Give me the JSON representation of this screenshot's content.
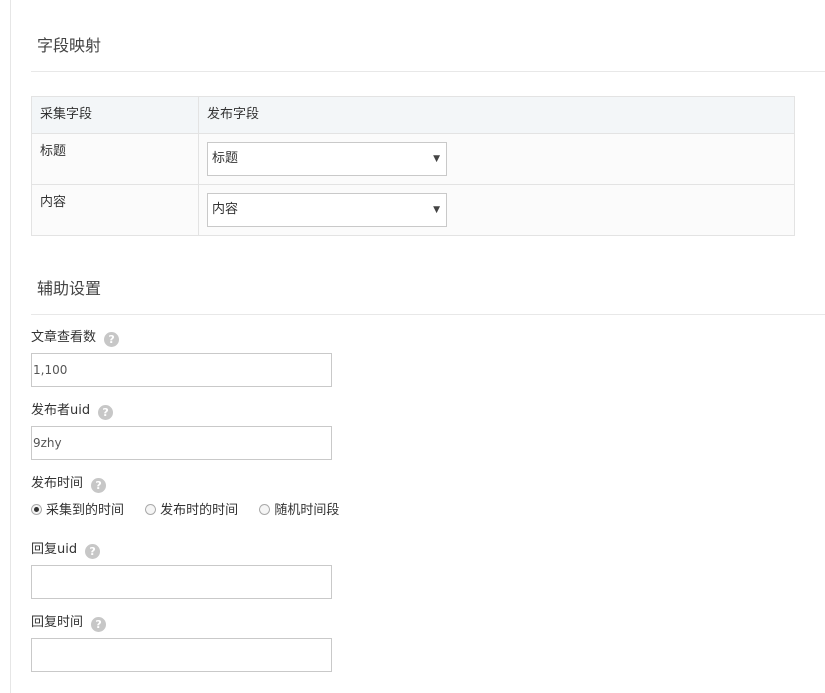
{
  "mapping": {
    "title": "字段映射",
    "columns": [
      "采集字段",
      "发布字段"
    ],
    "rows": [
      {
        "source": "标题",
        "target": "标题"
      },
      {
        "source": "内容",
        "target": "内容"
      }
    ]
  },
  "aux": {
    "title": "辅助设置",
    "view_count": {
      "label": "文章查看数",
      "value": "1,100"
    },
    "publisher_uid": {
      "label": "发布者uid",
      "value": "9zhy"
    },
    "publish_time": {
      "label": "发布时间",
      "options": [
        "采集到的时间",
        "发布时的时间",
        "随机时间段"
      ],
      "selected": "采集到的时间"
    },
    "reply_uid": {
      "label": "回复uid",
      "value": ""
    },
    "reply_time": {
      "label": "回复时间",
      "value": ""
    }
  },
  "icons": {
    "help": "question-circle-icon",
    "caret": "dropdown-arrow-icon"
  },
  "help_glyph": "?",
  "caret_glyph": "▼"
}
